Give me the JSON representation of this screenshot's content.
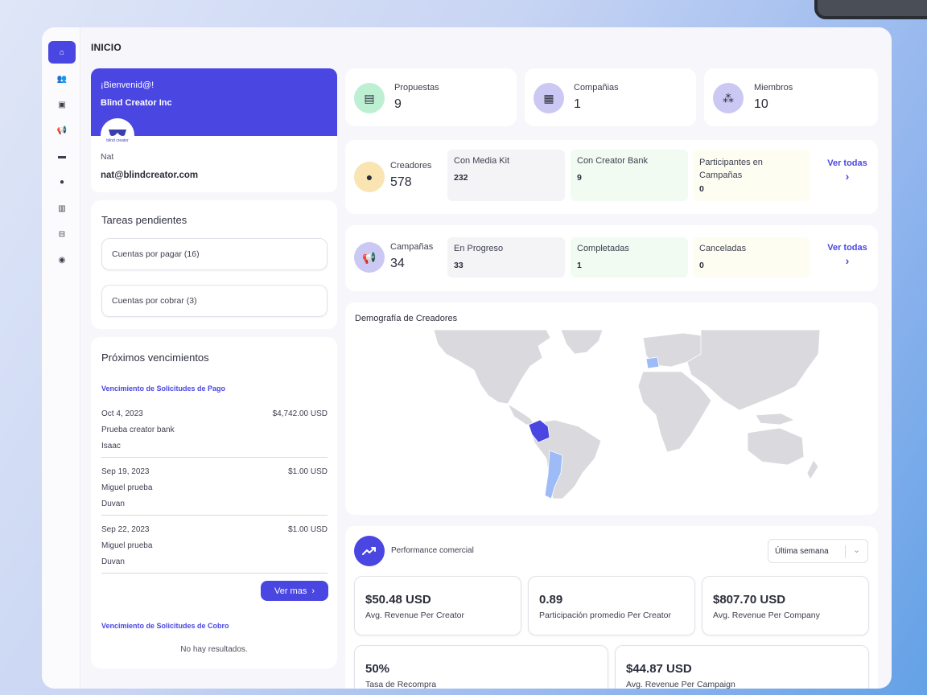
{
  "page": {
    "title": "INICIO"
  },
  "sidebar": {
    "items": [
      {
        "name": "home-icon",
        "glyph": "⌂"
      },
      {
        "name": "users-icon",
        "glyph": "👥"
      },
      {
        "name": "calendar-icon",
        "glyph": "▣"
      },
      {
        "name": "megaphone-icon",
        "glyph": "📢"
      },
      {
        "name": "wallet-icon",
        "glyph": "▬"
      },
      {
        "name": "user-icon",
        "glyph": "●"
      },
      {
        "name": "building-icon",
        "glyph": "▥"
      },
      {
        "name": "truck-icon",
        "glyph": "⊟"
      },
      {
        "name": "globe-icon",
        "glyph": "◉"
      }
    ]
  },
  "welcome": {
    "greeting": "¡Bienvenid@!",
    "company": "Blind Creator Inc",
    "logo_text": "blind creator",
    "user_name": "Nat",
    "user_email": "nat@blindcreator.com"
  },
  "tasks": {
    "title": "Tareas pendientes",
    "items": [
      "Cuentas por pagar (16)",
      "Cuentas por cobrar (3)"
    ]
  },
  "due": {
    "title": "Próximos vencimientos",
    "payment_title": "Vencimiento de Solicitudes de Pago",
    "rows": [
      {
        "date": "Oct 4, 2023",
        "amount": "$4,742.00 USD",
        "concept": "Prueba creator bank",
        "person": "Isaac"
      },
      {
        "date": "Sep 19, 2023",
        "amount": "$1.00 USD",
        "concept": "Miguel prueba",
        "person": "Duvan"
      },
      {
        "date": "Sep 22, 2023",
        "amount": "$1.00 USD",
        "concept": "Miguel prueba",
        "person": "Duvan"
      }
    ],
    "more_label": "Ver mas",
    "collection_title": "Vencimiento de Solicitudes de Cobro",
    "empty": "No hay resultados."
  },
  "stats": [
    {
      "label": "Propuestas",
      "value": "9",
      "icon": "list-icon",
      "color": "#bdf0d2"
    },
    {
      "label": "Compañias",
      "value": "1",
      "icon": "building-icon",
      "color": "#cbc8f4"
    },
    {
      "label": "Miembros",
      "value": "10",
      "icon": "members-icon",
      "color": "#cbc8f4"
    }
  ],
  "creators": {
    "label": "Creadores",
    "value": "578",
    "subs": [
      {
        "label": "Con Media Kit",
        "value": "232",
        "color": "#f4f4f7"
      },
      {
        "label": "Con Creator Bank",
        "value": "9",
        "color": "#f2fbf2"
      },
      {
        "label": "Participantes en Campañas",
        "value": "0",
        "color": "#fdfdf1"
      }
    ],
    "link": "Ver todas"
  },
  "campaigns": {
    "label": "Campañas",
    "value": "34",
    "subs": [
      {
        "label": "En Progreso",
        "value": "33",
        "color": "#f4f4f7"
      },
      {
        "label": "Completadas",
        "value": "1",
        "color": "#f2fbf2"
      },
      {
        "label": "Canceladas",
        "value": "0",
        "color": "#fdfdf1"
      }
    ],
    "link": "Ver todas"
  },
  "map": {
    "title": "Demografía de Creadores",
    "highlight_color": "#4a46e2",
    "secondary_color": "#9dbcf7",
    "land_color": "#d9d9de"
  },
  "performance": {
    "title": "Performance comercial",
    "period": "Última semana",
    "metrics": [
      {
        "value": "$50.48 USD",
        "label": "Avg. Revenue Per Creator"
      },
      {
        "value": "0.89",
        "label": "Participación promedio Per Creator"
      },
      {
        "value": "$807.70 USD",
        "label": "Avg. Revenue Per Company"
      },
      {
        "value": "50%",
        "label": "Tasa de Recompra"
      },
      {
        "value": "$44.87 USD",
        "label": "Avg. Revenue Per Campaign"
      }
    ]
  },
  "colors": {
    "accent": "#4a46e2"
  }
}
